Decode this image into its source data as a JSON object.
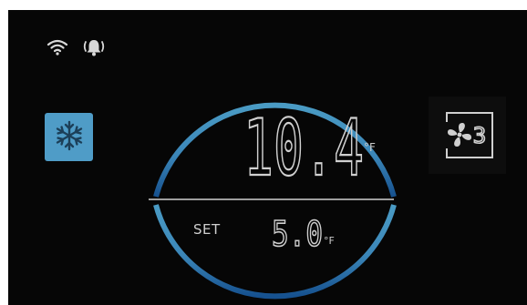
{
  "status": {
    "icons": [
      "wifi-icon",
      "alarm-bell-icon"
    ]
  },
  "mode": {
    "icon": "snowflake-icon",
    "color": "#4f9cc7"
  },
  "fan": {
    "icon": "fan-icon",
    "speed": "3"
  },
  "temperature": {
    "current": "10.4",
    "current_unit": "°F",
    "set_label": "SET",
    "set": "5.0",
    "set_unit": "°F"
  },
  "colors": {
    "background": "#060606",
    "ring_light": "#3f8fb8",
    "ring_dark": "#1f5d96",
    "digits": "#d0d0d0"
  }
}
